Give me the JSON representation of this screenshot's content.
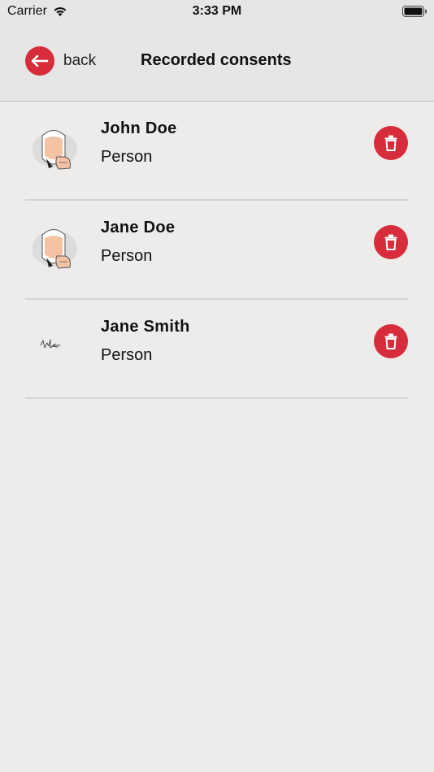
{
  "status": {
    "carrier": "Carrier",
    "time": "3:33 PM"
  },
  "header": {
    "back_label": "back",
    "title": "Recorded consents"
  },
  "consents": [
    {
      "name": "John Doe",
      "type": "Person",
      "thumbnail": "avatar-illustration"
    },
    {
      "name": "Jane Doe",
      "type": "Person",
      "thumbnail": "avatar-illustration"
    },
    {
      "name": "Jane Smith",
      "type": "Person",
      "thumbnail": "signature-scribble"
    }
  ],
  "colors": {
    "accent": "#d72c3b",
    "background": "#eeecea",
    "header": "#e6e6e6",
    "divider": "#d6d5d3"
  }
}
